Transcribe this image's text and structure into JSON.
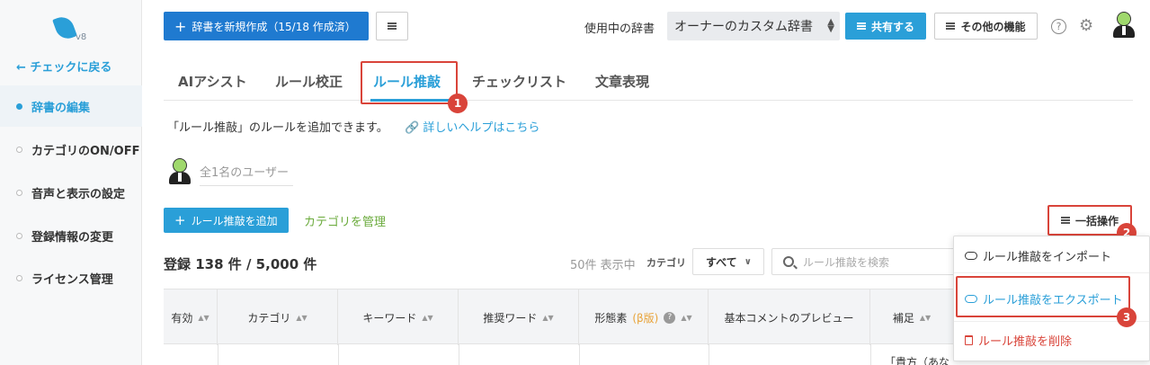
{
  "sidebar": {
    "version": "v8",
    "back": "← チェックに戻る",
    "items": [
      {
        "label": "辞書の編集"
      },
      {
        "label": "カテゴリのON/OFF"
      },
      {
        "label": "音声と表示の設定"
      },
      {
        "label": "登録情報の変更"
      },
      {
        "label": "ライセンス管理"
      }
    ]
  },
  "toolbar": {
    "new_dict_label": "辞書を新規作成（15/18 作成済）",
    "dict_in_use_label": "使用中の辞書",
    "dict_selected": "オーナーのカスタム辞書",
    "share_label": "共有する",
    "other_label": "その他の機能",
    "help_glyph": "?"
  },
  "tabs": [
    {
      "label": "AIアシスト"
    },
    {
      "label": "ルール校正"
    },
    {
      "label": "ルール推敲"
    },
    {
      "label": "チェックリスト"
    },
    {
      "label": "文章表現"
    }
  ],
  "description": "「ルール推敲」のルールを追加できます。",
  "help_link": "詳しいヘルプはこちら",
  "users_text": "全1名のユーザー",
  "actions": {
    "add_label": "ルール推敲を追加",
    "manage_categories": "カテゴリを管理",
    "bulk_label": "一括操作"
  },
  "list": {
    "count_label": "登録 138 件 / 5,000 件",
    "showing": "50件 表示中",
    "category_label": "カテゴリ",
    "category_value": "すべて",
    "search_placeholder": "ルール推敲を検索"
  },
  "table": {
    "columns": [
      "有効",
      "カテゴリ",
      "キーワード",
      "推奨ワード",
      "形態素",
      "(β版)",
      "基本コメントのプレビュー",
      "補足"
    ],
    "first_cell": "「貴方（あな"
  },
  "bulk_menu": {
    "import": "ルール推敲をインポート",
    "export": "ルール推敲をエクスポート",
    "delete": "ルール推敲を削除"
  },
  "annotations": [
    "1",
    "2",
    "3"
  ],
  "colors": {
    "accent": "#2a9fd8",
    "primary_button": "#1f7ad0",
    "highlight": "#d9443a",
    "category_link": "#6aaa3b",
    "delete": "#d9443a"
  }
}
